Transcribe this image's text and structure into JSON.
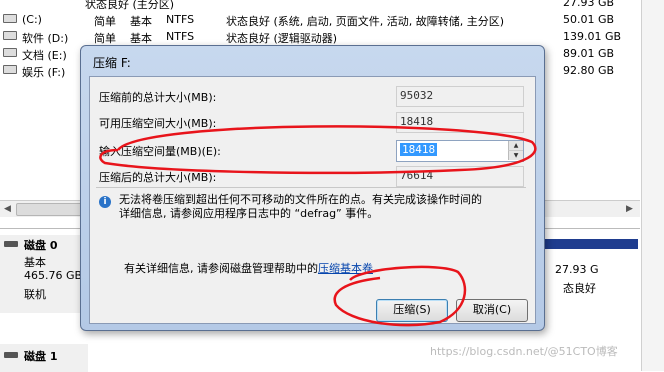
{
  "volumes": [
    {
      "name": "",
      "layout": "",
      "type": "",
      "fs": "",
      "status": "",
      "capacity": "27.93 GB"
    },
    {
      "name": "(C:)",
      "layout": "简单",
      "type": "基本",
      "fs": "NTFS",
      "status": "状态良好 (系统, 启动, 页面文件, 活动, 故障转储, 主分区)",
      "capacity": "50.01 GB"
    },
    {
      "name": "软件 (D:)",
      "layout": "简单",
      "type": "基本",
      "fs": "NTFS",
      "status": "状态良好 (逻辑驱动器)",
      "capacity": "139.01 GB"
    },
    {
      "name": "文档 (E:)",
      "layout": "",
      "type": "",
      "fs": "",
      "status": "",
      "capacity": "89.01 GB"
    },
    {
      "name": "娱乐 (F:)",
      "layout": "",
      "type": "",
      "fs": "",
      "status": "",
      "capacity": "92.80 GB"
    }
  ],
  "partial_status": "状态良好 (主分区)",
  "disks": [
    {
      "title": "磁盘 0",
      "type": "基本",
      "size": "465.76 GB",
      "state": "联机"
    },
    {
      "title": "磁盘 1"
    }
  ],
  "right_partition": {
    "capacity": "27.93 G",
    "status": "态良好"
  },
  "dialog": {
    "title": "压缩 F:",
    "fields": [
      {
        "label": "压缩前的总计大小(MB):",
        "value": "95032"
      },
      {
        "label": "可用压缩空间大小(MB):",
        "value": "18418"
      },
      {
        "label": "输入压缩空间量(MB)(E):",
        "value": "18418"
      },
      {
        "label": "压缩后的总计大小(MB):",
        "value": "76614"
      }
    ],
    "info_line1": "无法将卷压缩到超出任何不可移动的文件所在的点。有关完成该操作时间的",
    "info_line2": "详细信息, 请参阅应用程序日志中的 “defrag” 事件。",
    "help_prefix": "有关详细信息, 请参阅磁盘管理帮助中的",
    "help_link": "压缩基本卷",
    "compress_button": "压缩(S)",
    "cancel_button": "取消(C)"
  },
  "watermark": "https://blog.csdn.net/@51CTO博客",
  "colors": {
    "annotation": "#e8141b",
    "selection": "#3399ff",
    "link": "#0645ad",
    "partition_bar": "#1f3d8f"
  }
}
